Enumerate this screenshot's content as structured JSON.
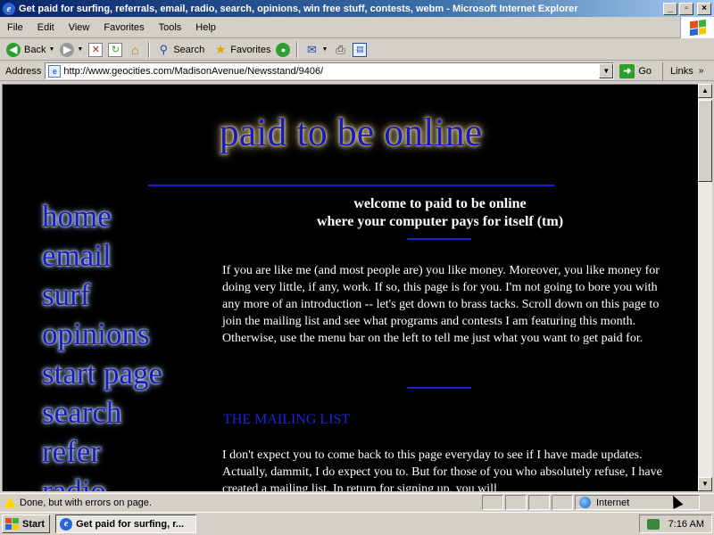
{
  "window": {
    "title": "Get paid for surfing, referrals, email, radio, search, opinions, win free stuff, contests, webm - Microsoft Internet Explorer",
    "min_label": "_",
    "max_label": "▫",
    "close_label": "×"
  },
  "menu": [
    "File",
    "Edit",
    "View",
    "Favorites",
    "Tools",
    "Help"
  ],
  "toolbar": {
    "back_label": "Back",
    "search_label": "Search",
    "favorites_label": "Favorites"
  },
  "address": {
    "label": "Address",
    "url": "http://www.geocities.com/MadisonAvenue/Newsstand/9406/",
    "go_label": "Go",
    "links_label": "Links"
  },
  "page": {
    "site_title": "paid to be online",
    "nav": [
      "home",
      "email",
      "surf",
      "opinions",
      "start page",
      "search",
      "refer",
      "radio"
    ],
    "welcome_line1": "welcome to paid to be online",
    "welcome_line2": "where your computer pays for itself (tm)",
    "intro": "If you are like me (and most people are) you like money. Moreover, you like money for doing very little, if any, work. If so, this page is for you. I'm not going to bore you with any more of an introduction -- let's get down to brass tacks. Scroll down on this page to join the mailing list and see what programs and contests I am featuring this month. Otherwise, use the menu bar on the left to tell me just what you want to get paid for.",
    "mailing_heading": "THE MAILING LIST",
    "mailing_text": "I don't expect you to come back to this page everyday to see if I have made updates. Actually, dammit, I do expect you to. But for those of you who absolutely refuse, I have created a mailing list. In return for signing up, you will"
  },
  "status": {
    "text": "Done, but with errors on page.",
    "zone": "Internet"
  },
  "taskbar": {
    "start_label": "Start",
    "task_label": "Get paid for surfing, r...",
    "clock": "7:16 AM"
  },
  "colors": {
    "page_bg": "#000000",
    "link_blue": "#1a1ab8",
    "rule_blue": "#2020d0",
    "heading_blue": "#2020e0"
  }
}
